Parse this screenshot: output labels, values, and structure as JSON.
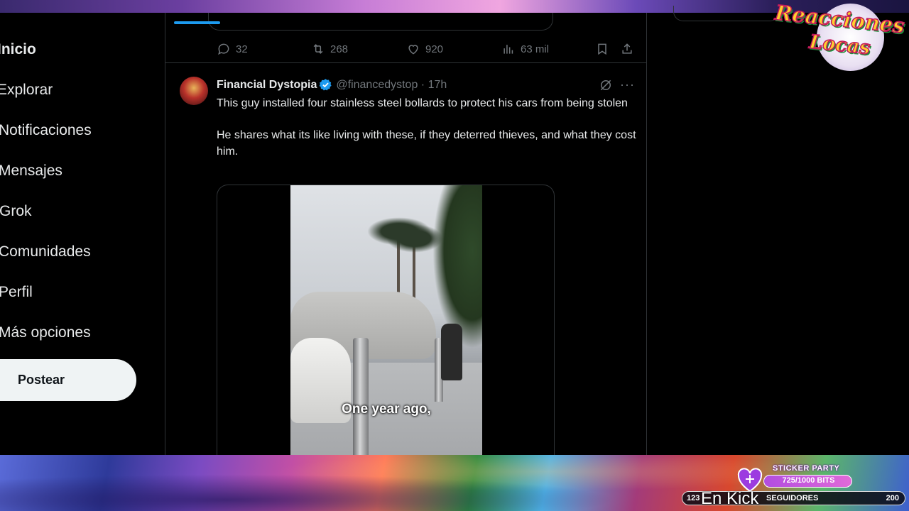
{
  "nav": {
    "items": [
      {
        "label": "Inicio",
        "active": true
      },
      {
        "label": "Explorar"
      },
      {
        "label": "Notificaciones"
      },
      {
        "label": "Mensajes"
      },
      {
        "label": "Grok"
      },
      {
        "label": "Comunidades"
      },
      {
        "label": "Perfil"
      },
      {
        "label": "Más opciones"
      }
    ],
    "post_button": "Postear"
  },
  "previous_tweet": {
    "replies": "32",
    "reposts": "268",
    "likes": "920",
    "views": "63 mil"
  },
  "tweet": {
    "author_name": "Financial Dystopia",
    "verified": true,
    "handle_time": "@financedystop · 17h",
    "text_1": "This guy installed four stainless steel bollards to protect his cars from being stolen",
    "text_2": "He shares what its like living with these, if they deterred thieves, and what they cost him.",
    "video_caption": "One year ago,"
  },
  "overlay": {
    "logo_line1": "Reacciones",
    "logo_line2": "Locas",
    "sticker_title": "STICKER PARTY",
    "bits": "725/1000 BITS",
    "follower_min": "123",
    "follower_label": "SEGUIDORES",
    "follower_max": "200",
    "en_kick": "En Kick"
  },
  "colors": {
    "accent": "#1d9bf0",
    "background": "#000000",
    "border": "#2f3336",
    "muted": "#71767b"
  }
}
